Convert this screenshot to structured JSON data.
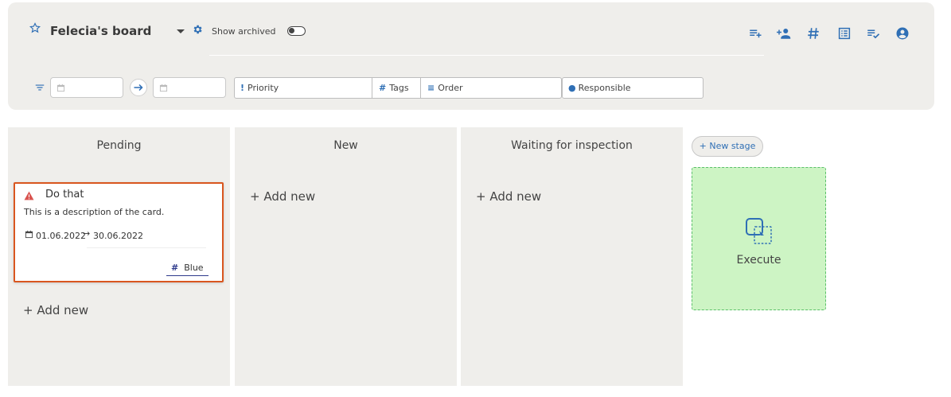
{
  "header": {
    "board_title": "Felecia's board",
    "show_archived_label": "Show archived"
  },
  "toolbar": {
    "icons": [
      "add-list-icon",
      "add-user-icon",
      "hashtag-icon",
      "table-view-icon",
      "checklist-icon",
      "account-circle-icon"
    ]
  },
  "filters": {
    "date_from_value": "",
    "date_to_value": "",
    "priority_label": "Priority",
    "tags_label": "Tags",
    "order_label": "Order",
    "responsible_label": "Responsible"
  },
  "columns": [
    {
      "title": "Pending",
      "add_new_label": "+ Add new",
      "cards": [
        {
          "title": "Do that",
          "description": "This is a description of the card.",
          "date_start": "01.06.2022",
          "date_arrow": "→",
          "date_end": "30.06.2022",
          "tag": "Blue"
        }
      ]
    },
    {
      "title": "New",
      "add_new_label": "+ Add new",
      "cards": []
    },
    {
      "title": "Waiting for inspection",
      "add_new_label": "+ Add new",
      "cards": []
    }
  ],
  "new_stage_label": "+ New stage",
  "execute_label": "Execute",
  "colors": {
    "accent_blue": "#2f6fb5",
    "card_border": "#d9561f",
    "warning_red": "#d9534f",
    "execute_bg": "#cdf4c4",
    "execute_border": "#5ac06a",
    "tag_color": "#2e3a8c"
  }
}
